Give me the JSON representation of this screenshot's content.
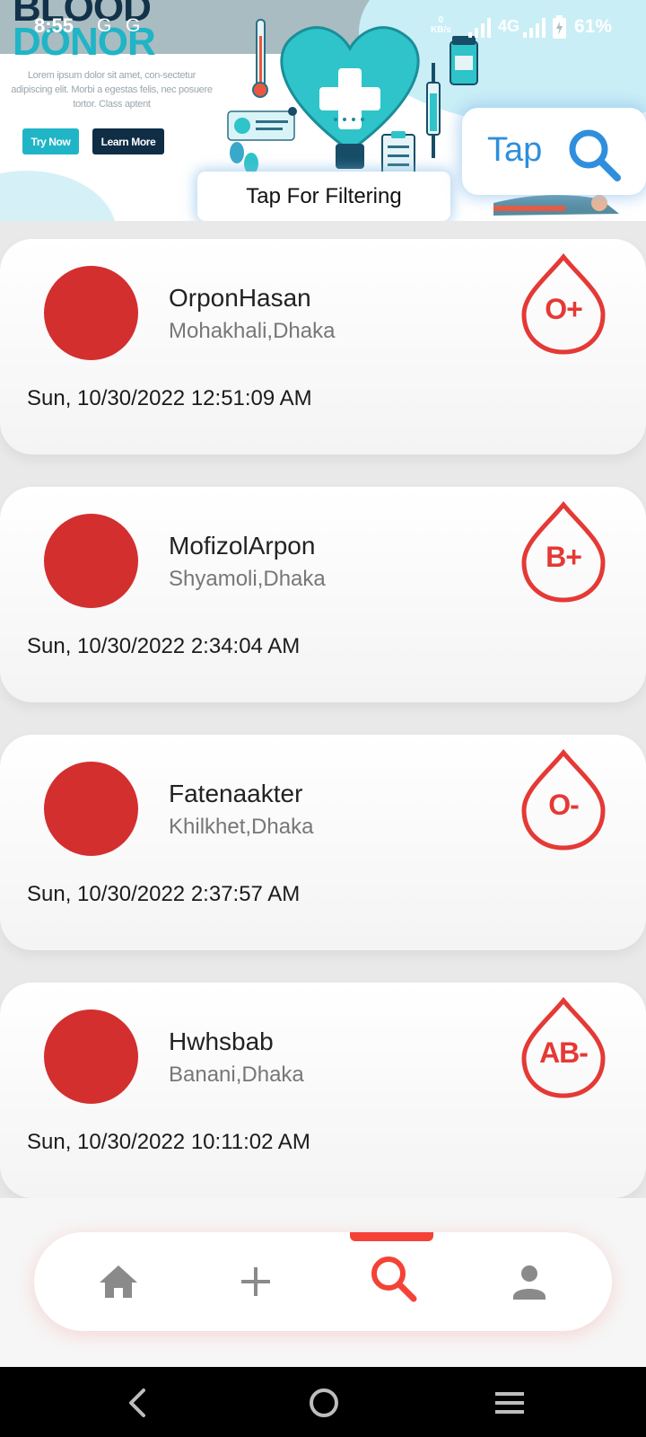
{
  "status_bar": {
    "time": "8:55",
    "notif_icons": [
      "G",
      "G"
    ],
    "speed_value": "0",
    "speed_unit": "KB/s",
    "network": "4G",
    "battery": "61%"
  },
  "banner": {
    "brand_line1": "BLOOD",
    "brand_line2": "DONOR",
    "lorem": "Lorem ipsum dolor sit amet, con-sectetur adipiscing elit. Morbi a egestas felis, nec posuere tortor. Class aptent",
    "try_now": "Try Now",
    "learn_more": "Learn More",
    "filter_label": "Tap For Filtering",
    "tap_label": "Tap"
  },
  "donors": [
    {
      "name": "OrponHasan",
      "location": "Mohakhali,Dhaka",
      "date": "Sun, 10/30/2022 12:51:09 AM",
      "blood_group": "O+"
    },
    {
      "name": "MofizolArpon",
      "location": "Shyamoli,Dhaka",
      "date": "Sun, 10/30/2022 2:34:04 AM",
      "blood_group": "B+"
    },
    {
      "name": "Fatenaakter",
      "location": "Khilkhet,Dhaka",
      "date": "Sun, 10/30/2022 2:37:57 AM",
      "blood_group": "O-"
    },
    {
      "name": "Hwhsbab",
      "location": "Banani,Dhaka",
      "date": "Sun, 10/30/2022 10:11:02 AM",
      "blood_group": "AB-"
    }
  ],
  "nav": {
    "items": [
      {
        "icon": "home-icon"
      },
      {
        "icon": "plus-icon"
      },
      {
        "icon": "search-icon",
        "active": true
      },
      {
        "icon": "person-icon"
      }
    ]
  },
  "colors": {
    "accent": "#f44336",
    "avatar": "#d32f2f",
    "teal": "#1fb5c6",
    "navy": "#0f2d45",
    "tap_blue": "#2f8fdd"
  }
}
